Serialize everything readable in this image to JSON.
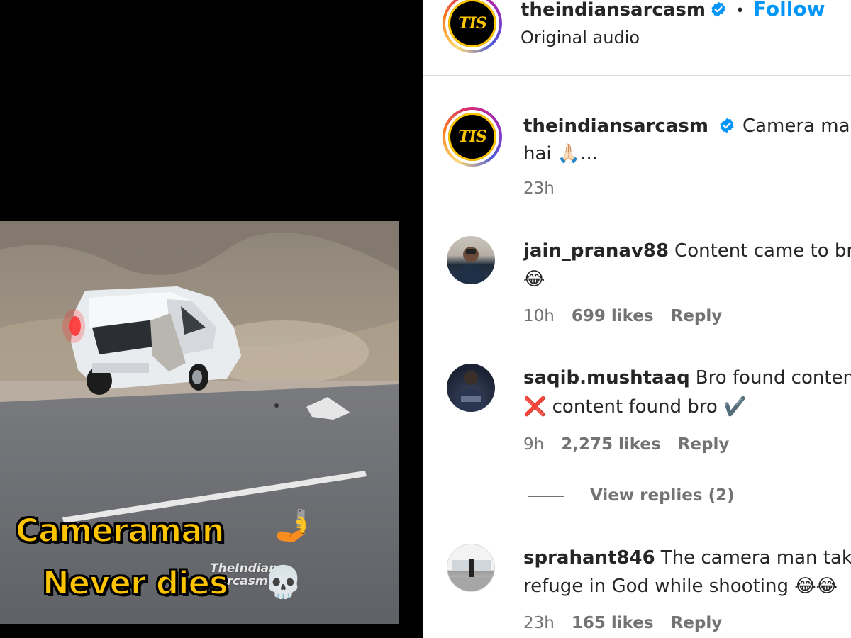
{
  "video": {
    "watermark_line1": "TheIndian",
    "watermark_line2": "Sarcasm",
    "caption_line1": "Cameraman",
    "caption_line1_emoji": "🤳",
    "caption_line2": "Never dies",
    "caption_line2_emoji": "💀"
  },
  "header": {
    "avatar_text": "TIS",
    "username": "theindiansarcasm",
    "separator": "•",
    "follow_label": "Follow",
    "audio_label": "Original audio"
  },
  "caption": {
    "avatar_text": "TIS",
    "username": "theindiansarcasm",
    "text_line1": "Camera man a",
    "text_line2": "hai 🙏🏻...",
    "time": "23h"
  },
  "comments": [
    {
      "username": "jain_pranav88",
      "text_line1": "Content came to bro",
      "text_line2": "😂",
      "time": "10h",
      "likes": "699 likes",
      "reply_label": "Reply"
    },
    {
      "username": "saqib.mushtaaq",
      "text_line1": "Bro found content",
      "text_line2": "❌ content found bro ✔️",
      "time": "9h",
      "likes": "2,275 likes",
      "reply_label": "Reply",
      "view_replies": "View replies (2)"
    },
    {
      "username": "sprahant846",
      "text_line1": "The camera man takes",
      "text_line2": "refuge in God while shooting 😂😂",
      "time": "23h",
      "likes": "165 likes",
      "reply_label": "Reply"
    }
  ],
  "colors": {
    "follow_blue": "#0095f6",
    "verified_blue": "#0095f6",
    "muted_text": "#737373",
    "caption_yellow": "#ffc400"
  }
}
